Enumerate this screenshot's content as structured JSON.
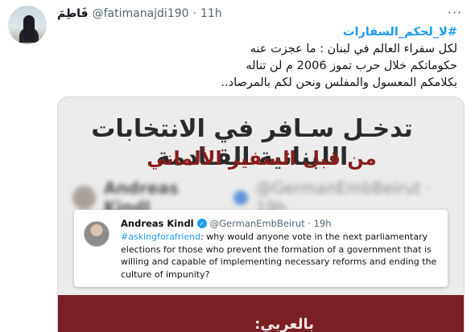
{
  "tweet": {
    "display_name": "فَاطِمَ",
    "handle": "@fatimanajdi190",
    "separator": "·",
    "time": "11h",
    "more_label": "···",
    "hashtag": "#لا_لحكم_السفارات",
    "lines": [
      "لكل سفراء العالم في لبنان : ما عجزت عنه",
      "حكوماتكم خلال حرب تموز 2006 م لن تناله",
      "بكلامكم المعسول والمفلس ونحن لكم بالمرصاد.."
    ]
  },
  "media": {
    "title_line1": "تدخـل سـافر في الانتخابات اللبنانية القـادمة",
    "title_line2": "من قبل السفير الألماني",
    "blurred_name": "Andreas Kindl",
    "blurred_handle": "@GermanEmbBeirut · 19h",
    "embedded_tweet": {
      "name": "Andreas Kindl",
      "verified_mark": "✓",
      "handle_time": "@GermanEmbBeirut · 19h",
      "hashtag": "#askingforafriend",
      "text": ": why would anyone vote in the next parliamentary elections for those who prevent the formation of a government that is willing and capable of implementing necessary reforms and ending the culture of impunity?"
    },
    "band_text": "بالعربي:"
  },
  "colors": {
    "link": "#1d9bf0",
    "band": "#7a1f24",
    "title_red": "#8a1c1c"
  }
}
